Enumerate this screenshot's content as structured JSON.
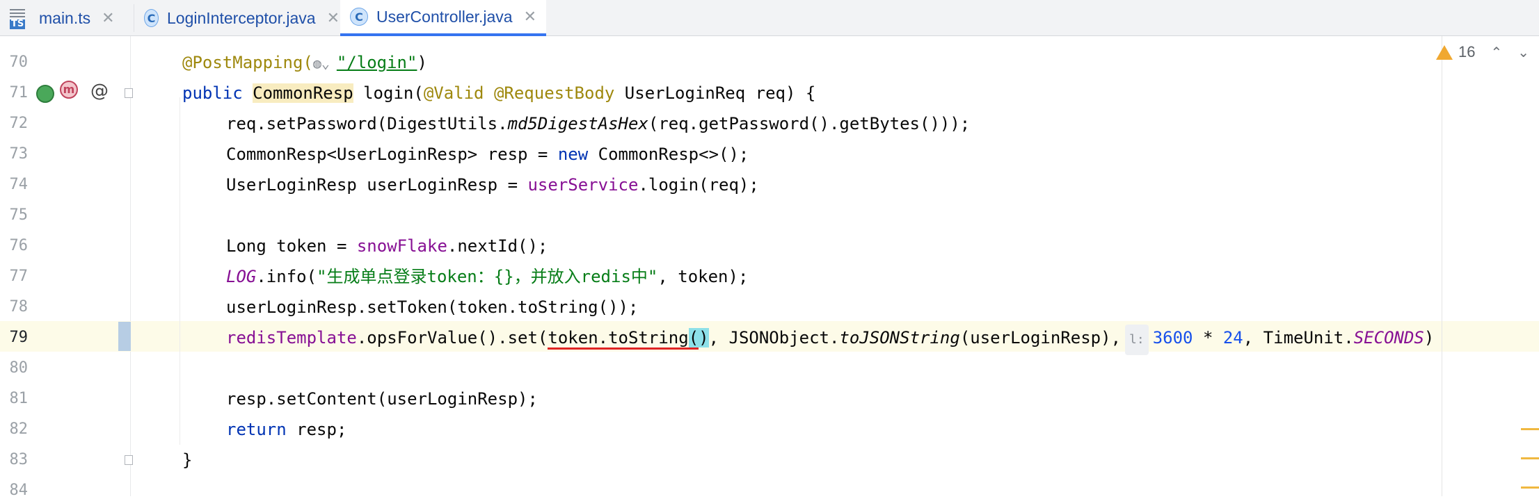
{
  "tabs": [
    {
      "label": "main.ts",
      "icon": "typescript-file-icon",
      "icon_text": "TS",
      "active": false
    },
    {
      "label": "LoginInterceptor.java",
      "icon": "java-class-icon",
      "icon_text": "C",
      "active": false
    },
    {
      "label": "UserController.java",
      "icon": "java-class-icon",
      "icon_text": "C",
      "active": true
    }
  ],
  "close_glyph": "✕",
  "inspections": {
    "warning_count": "16",
    "up": "⌃",
    "down": "⌄"
  },
  "gutter": {
    "method_icon_text": "m",
    "at_icon": "@"
  },
  "line_numbers": [
    "70",
    "71",
    "72",
    "73",
    "74",
    "75",
    "76",
    "77",
    "78",
    "79",
    "80",
    "81",
    "82",
    "83",
    "84"
  ],
  "current_line": "79",
  "code": {
    "l70_ann": "@PostMapping(",
    "l70_url": "\"/login\"",
    "l70_end": ")",
    "l71_pub": "public ",
    "l71_type": "CommonResp",
    "l71_sig": " login(",
    "l71_anns": "@Valid @RequestBody",
    "l71_rest": " UserLoginReq req) {",
    "l72_a": "req.setPassword(DigestUtils.",
    "l72_b": "md5DigestAsHex",
    "l72_c": "(req.getPassword().getBytes()));",
    "l73_a": "CommonResp<UserLoginResp> resp = ",
    "l73_new": "new",
    "l73_b": " CommonResp<>();",
    "l74_a": "UserLoginResp userLoginResp = ",
    "l74_fld": "userService",
    "l74_b": ".login(req);",
    "l76_a": "Long token = ",
    "l76_fld": "snowFlake",
    "l76_b": ".nextId();",
    "l77_log": "LOG",
    "l77_a": ".info(",
    "l77_str": "\"生成单点登录token：{}，并放入redis中\"",
    "l77_b": ", token);",
    "l78": "userLoginResp.setToken(token.toString());",
    "l79_fld": "redisTemplate",
    "l79_a": ".opsForValue().set(",
    "l79_u": "token.toString",
    "l79_paren_open": "(",
    "l79_paren_close": ")",
    "l79_b": ", JSONObject.",
    "l79_method": "toJSONString",
    "l79_c": "(userLoginResp),",
    "l79_hint": "l:",
    "l79_num1": "3600",
    "l79_op": " * ",
    "l79_num2": "24",
    "l79_d": ", TimeUnit.",
    "l79_const": "SECONDS",
    "l79_e": ")",
    "l81": "resp.setContent(userLoginResp);",
    "l82_ret": "return",
    "l82_b": " resp;",
    "l83": "}"
  }
}
